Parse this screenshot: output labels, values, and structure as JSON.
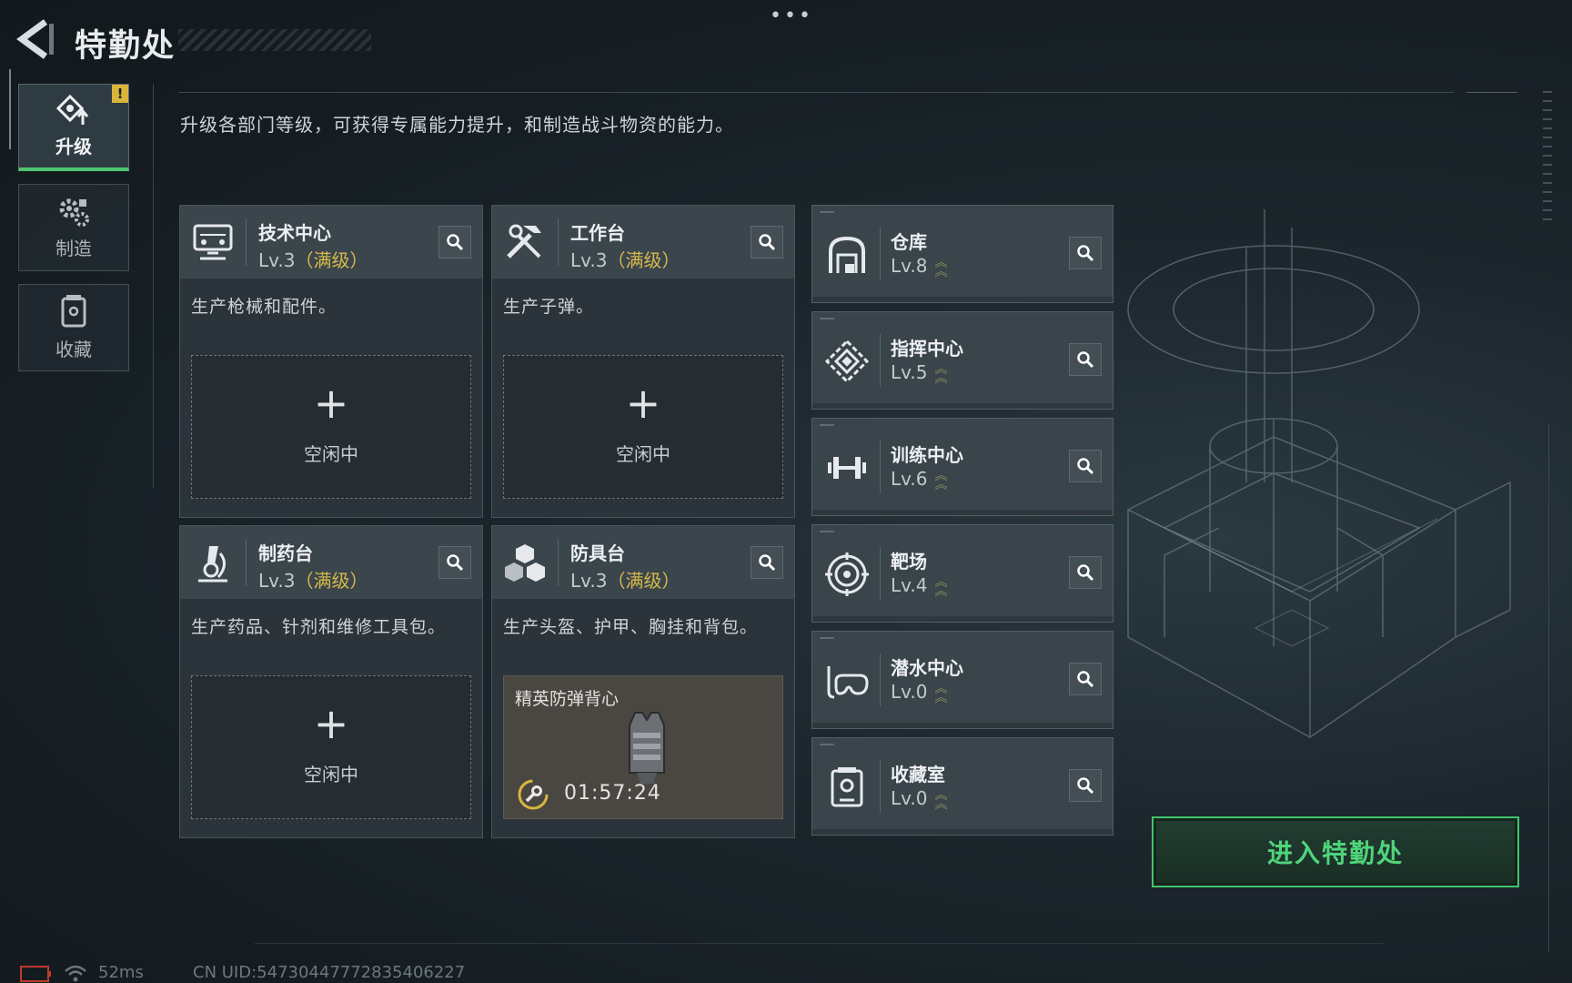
{
  "header": {
    "title": "特勤处",
    "dots": "•••",
    "description": "升级各部门等级，可获得专属能力提升，和制造战斗物资的能力。"
  },
  "sidebar": {
    "items": [
      {
        "label": "升级",
        "icon": "upgrade-icon",
        "active": true,
        "badge": "!"
      },
      {
        "label": "制造",
        "icon": "gears-icon",
        "active": false
      },
      {
        "label": "收藏",
        "icon": "collection-icon",
        "active": false
      }
    ]
  },
  "workshops": [
    {
      "name": "技术中心",
      "level": "Lv.3",
      "max": "（满级）",
      "desc": "生产枪械和配件。",
      "slot": {
        "state": "idle",
        "plus": "+",
        "text": "空闲中"
      }
    },
    {
      "name": "工作台",
      "level": "Lv.3",
      "max": "（满级）",
      "desc": "生产子弹。",
      "slot": {
        "state": "idle",
        "plus": "+",
        "text": "空闲中"
      }
    },
    {
      "name": "制药台",
      "level": "Lv.3",
      "max": "（满级）",
      "desc": "生产药品、针剂和维修工具包。",
      "slot": {
        "state": "idle",
        "plus": "+",
        "text": "空闲中"
      }
    },
    {
      "name": "防具台",
      "level": "Lv.3",
      "max": "（满级）",
      "desc": "生产头盔、护甲、胸挂和背包。",
      "slot": {
        "state": "crafting",
        "item": "精英防弹背心",
        "time": "01:57:24"
      }
    }
  ],
  "facilities": [
    {
      "name": "仓库",
      "level": "Lv.8",
      "icon": "warehouse-icon"
    },
    {
      "name": "指挥中心",
      "level": "Lv.5",
      "icon": "command-center-icon"
    },
    {
      "name": "训练中心",
      "level": "Lv.6",
      "icon": "dumbbell-icon"
    },
    {
      "name": "靶场",
      "level": "Lv.4",
      "icon": "target-icon"
    },
    {
      "name": "潜水中心",
      "level": "Lv.0",
      "icon": "diving-mask-icon"
    },
    {
      "name": "收藏室",
      "level": "Lv.0",
      "icon": "collection-room-icon"
    }
  ],
  "enter_button": "进入特勤处",
  "status": {
    "ping": "52ms",
    "uid": "CN UID:547304477728354062​27"
  },
  "colors": {
    "accent_green": "#4fd47a",
    "max_level_gold": "#d6b94a",
    "badge_yellow": "#d9b53b"
  }
}
